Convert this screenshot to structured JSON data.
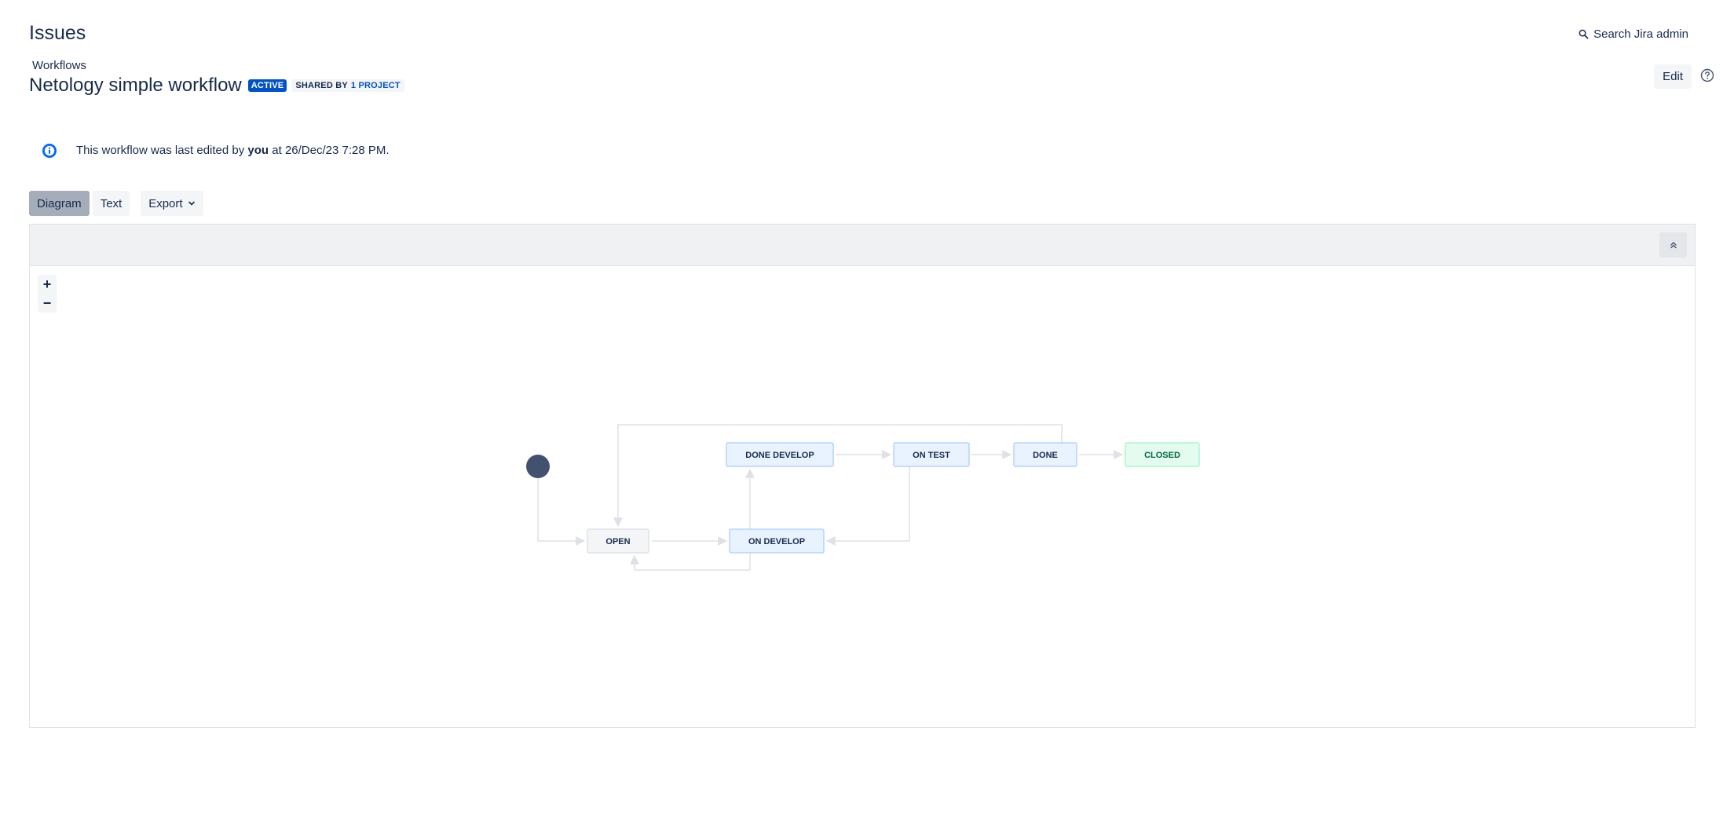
{
  "header": {
    "title": "Issues",
    "search_admin": "Search Jira admin"
  },
  "breadcrumb": "Workflows",
  "workflow": {
    "name": "Netology simple workflow",
    "status_lozenge": "ACTIVE",
    "shared_prefix": "SHARED BY",
    "shared_link": "1 PROJECT"
  },
  "actions": {
    "edit": "Edit"
  },
  "info": {
    "prefix": "This workflow was last edited by",
    "user": "you",
    "suffix": "at 26/Dec/23 7:28 PM."
  },
  "view_tabs": {
    "diagram": "Diagram",
    "text": "Text",
    "export": "Export",
    "selected": "Diagram"
  },
  "zoom": {
    "in": "+",
    "out": "−"
  },
  "statuses": [
    {
      "id": "open",
      "label": "OPEN",
      "category": "todo"
    },
    {
      "id": "on_develop",
      "label": "ON DEVELOP",
      "category": "in_progress"
    },
    {
      "id": "done_develop",
      "label": "DONE DEVELOP",
      "category": "in_progress"
    },
    {
      "id": "on_test",
      "label": "ON TEST",
      "category": "in_progress"
    },
    {
      "id": "done",
      "label": "DONE",
      "category": "in_progress"
    },
    {
      "id": "closed",
      "label": "CLOSED",
      "category": "done"
    }
  ],
  "transitions": [
    {
      "from": "start",
      "to": "open"
    },
    {
      "from": "open",
      "to": "on_develop"
    },
    {
      "from": "on_develop",
      "to": "open"
    },
    {
      "from": "on_develop",
      "to": "done_develop"
    },
    {
      "from": "done_develop",
      "to": "on_test"
    },
    {
      "from": "on_test",
      "to": "done"
    },
    {
      "from": "on_test",
      "to": "on_develop"
    },
    {
      "from": "done",
      "to": "closed"
    },
    {
      "from": "done",
      "to": "open"
    }
  ],
  "colors": {
    "todo_fill": "#f4f5f7",
    "todo_stroke": "#dfe1e6",
    "progress_fill": "#e9f2ff",
    "progress_stroke": "#b3d4ff",
    "done_fill": "#e3fcef",
    "done_stroke": "#abf5d1",
    "accent": "#0052cc",
    "start_node": "#42526e"
  }
}
